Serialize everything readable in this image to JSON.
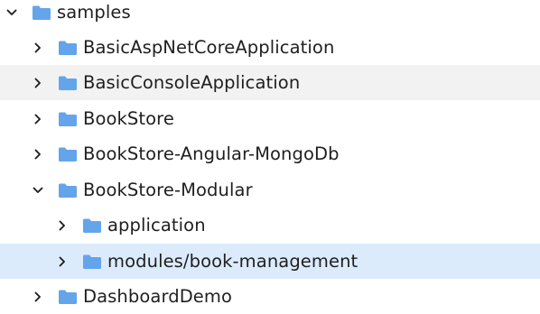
{
  "colors": {
    "folder": "#64a4ea",
    "chevron": "#1f1f1f",
    "hover_row": "#f2f2f2",
    "selected_row": "#dcebfb",
    "text": "#1f1f1f"
  },
  "tree": {
    "root": {
      "label": "samples",
      "state": "expanded",
      "icon": "folder-icon"
    },
    "items": [
      {
        "label": "BasicAspNetCoreApplication",
        "state": "collapsed",
        "icon": "folder-icon"
      },
      {
        "label": "BasicConsoleApplication",
        "state": "collapsed",
        "icon": "folder-icon",
        "hovered": true
      },
      {
        "label": "BookStore",
        "state": "collapsed",
        "icon": "folder-icon"
      },
      {
        "label": "BookStore-Angular-MongoDb",
        "state": "collapsed",
        "icon": "folder-icon"
      },
      {
        "label": "BookStore-Modular",
        "state": "expanded",
        "icon": "folder-icon"
      },
      {
        "label": "application",
        "state": "collapsed",
        "icon": "folder-icon"
      },
      {
        "label": "modules/book-management",
        "state": "collapsed",
        "icon": "folder-icon",
        "selected": true
      },
      {
        "label": "DashboardDemo",
        "state": "collapsed",
        "icon": "folder-icon"
      }
    ]
  }
}
